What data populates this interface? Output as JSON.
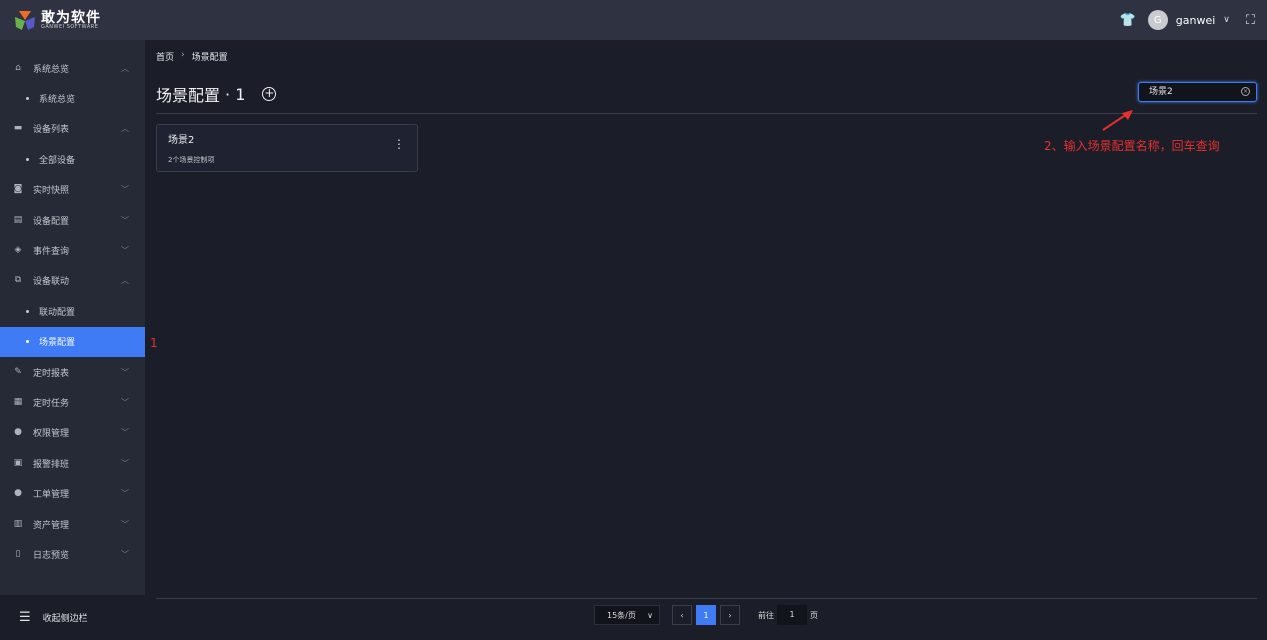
{
  "header": {
    "logo_cn": "敢为软件",
    "logo_en": "GANWEI SOFTWARE",
    "user_initial": "G",
    "username": "ganwei"
  },
  "sidebar": {
    "items": [
      {
        "label": "系统总览",
        "icon": "home-icon",
        "glyph": "⌂",
        "chev": "^",
        "type": "group"
      },
      {
        "label": "系统总览",
        "type": "sub"
      },
      {
        "label": "设备列表",
        "icon": "monitor-icon",
        "glyph": "▬",
        "chev": "^",
        "type": "group"
      },
      {
        "label": "全部设备",
        "type": "sub"
      },
      {
        "label": "实时快照",
        "icon": "camera-icon",
        "glyph": "◙",
        "chev": "v",
        "type": "group"
      },
      {
        "label": "设备配置",
        "icon": "device-config-icon",
        "glyph": "▤",
        "chev": "v",
        "type": "group"
      },
      {
        "label": "事件查询",
        "icon": "event-icon",
        "glyph": "◈",
        "chev": "v",
        "type": "group"
      },
      {
        "label": "设备联动",
        "icon": "linkage-icon",
        "glyph": "⧉",
        "chev": "^",
        "type": "group"
      },
      {
        "label": "联动配置",
        "type": "sub"
      },
      {
        "label": "场景配置",
        "type": "sub",
        "active": true
      },
      {
        "label": "定时报表",
        "icon": "report-icon",
        "glyph": "✎",
        "chev": "v",
        "type": "group"
      },
      {
        "label": "定时任务",
        "icon": "task-icon",
        "glyph": "▦",
        "chev": "v",
        "type": "group"
      },
      {
        "label": "权限管理",
        "icon": "user-icon",
        "glyph": "●",
        "chev": "v",
        "type": "group"
      },
      {
        "label": "报警排班",
        "icon": "schedule-icon",
        "glyph": "▣",
        "chev": "v",
        "type": "group"
      },
      {
        "label": "工单管理",
        "icon": "workorder-icon",
        "glyph": "●",
        "chev": "v",
        "type": "group"
      },
      {
        "label": "资产管理",
        "icon": "asset-icon",
        "glyph": "▥",
        "chev": "v",
        "type": "group"
      },
      {
        "label": "日志预览",
        "icon": "log-icon",
        "glyph": "▯",
        "chev": "v",
        "type": "group"
      }
    ],
    "collapse_label": "收起侧边栏"
  },
  "breadcrumb": {
    "home": "首页",
    "current": "场景配置"
  },
  "page": {
    "title": "场景配置",
    "count": "· 1"
  },
  "search": {
    "value": "场景2"
  },
  "cards": [
    {
      "name": "场景2",
      "desc": "2个场景控制项"
    }
  ],
  "annotations": {
    "step1": "1",
    "step2": "2、输入场景配置名称，回车查询"
  },
  "pagination": {
    "page_size": "15条/页",
    "current": "1",
    "goto_label": "前往",
    "goto_value": "1",
    "page_suffix": "页"
  }
}
